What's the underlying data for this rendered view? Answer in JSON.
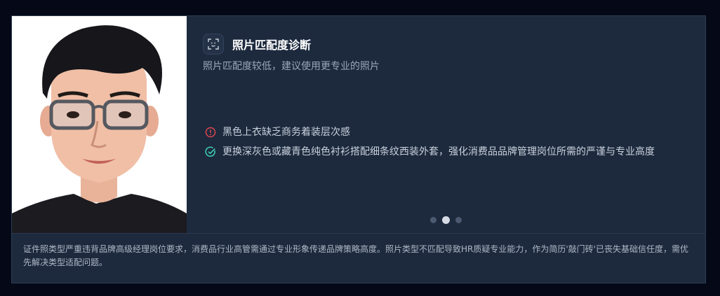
{
  "header": {
    "icon": "face-scan-icon",
    "title": "照片匹配度诊断",
    "subtitle": "照片匹配度较低，建议使用更专业的照片"
  },
  "issues": [
    {
      "type": "warning",
      "icon": "alert-circle-icon",
      "color": "#e0454f",
      "text": "黑色上衣缺乏商务着装层次感"
    },
    {
      "type": "suggestion",
      "icon": "check-circle-icon",
      "color": "#3fd3b6",
      "text": "更换深灰色或藏青色纯色衬衫搭配细条纹西装外套，强化消费品品牌管理岗位所需的严谨与专业高度"
    }
  ],
  "pagination": {
    "count": 3,
    "active_index": 1
  },
  "footer": {
    "text": "证件照类型严重违背品牌高级经理岗位要求，消费品行业高管需通过专业形象传递品牌策略高度。照片类型不匹配导致HR质疑专业能力，作为简历'敲门砖'已丧失基础信任度，需优先解决类型适配问题。"
  },
  "colors": {
    "page_background": "#050817",
    "card_background": "#1d2a3e",
    "photo_background": "#ffffff"
  }
}
